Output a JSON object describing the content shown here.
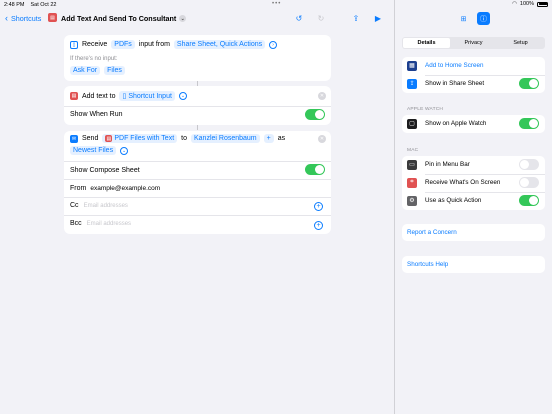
{
  "status": {
    "time": "2:48 PM",
    "date": "Sat Oct 22",
    "battery": "100%"
  },
  "topbar": {
    "back_label": "Shortcuts",
    "title": "Add Text And Send To Consultant"
  },
  "action_receive": {
    "verb": "Receive",
    "type": "PDFs",
    "mid": "input from",
    "source": "Share Sheet, Quick Actions",
    "no_input_label": "If there's no input:",
    "fallback_action": "Ask For",
    "fallback_type": "Files"
  },
  "action_addtext": {
    "verb": "Add text to",
    "target": "Shortcut Input",
    "show_label": "Show When Run",
    "show_on": true
  },
  "action_send": {
    "verb": "Send",
    "what": "PDF Files with Text",
    "to": "to",
    "recipient": "Kanzlei Rosenbaum",
    "plus": "+",
    "as": "as",
    "name": "Newest Files",
    "compose_label": "Show Compose Sheet",
    "compose_on": true,
    "from_label": "From",
    "from_value": "example@example.com",
    "cc_label": "Cc",
    "cc_placeholder": "Email addresses",
    "bcc_label": "Bcc",
    "bcc_placeholder": "Email addresses"
  },
  "panel": {
    "tabs": [
      "Details",
      "Privacy",
      "Setup"
    ],
    "active_tab": "Details",
    "home_screen": "Add to Home Screen",
    "share_sheet": "Show in Share Sheet",
    "apple_watch_header": "APPLE WATCH",
    "watch_label": "Show on Apple Watch",
    "mac_header": "MAC",
    "menu_bar": "Pin in Menu Bar",
    "receive_screen": "Receive What's On Screen",
    "quick_action": "Use as Quick Action",
    "report": "Report a Concern",
    "help": "Shortcuts Help"
  },
  "colors": {
    "accent": "#0a7cff",
    "green": "#34c759",
    "red": "#e05252"
  }
}
